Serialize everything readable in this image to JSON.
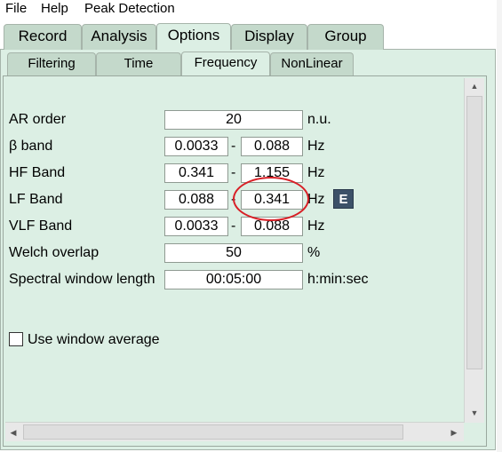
{
  "menubar": {
    "file": "File",
    "help": "Help",
    "peak_detection": "Peak Detection"
  },
  "main_tabs": [
    {
      "label": "Record",
      "active": false
    },
    {
      "label": "Analysis",
      "active": false
    },
    {
      "label": "Options",
      "active": true
    },
    {
      "label": "Display",
      "active": false
    },
    {
      "label": "Group",
      "active": false
    }
  ],
  "sub_tabs": [
    {
      "label": "Filtering",
      "active": false
    },
    {
      "label": "Time",
      "active": false
    },
    {
      "label": "Frequency",
      "active": true
    },
    {
      "label": "NonLinear",
      "active": false
    }
  ],
  "form": {
    "ar_order": {
      "label": "AR order",
      "value": "20",
      "unit": "n.u."
    },
    "beta_band": {
      "label": "β band",
      "low": "0.0033",
      "high": "0.088",
      "unit": "Hz"
    },
    "hf_band": {
      "label": "HF Band",
      "low": "0.341",
      "high": "1.155",
      "unit": "Hz"
    },
    "lf_band": {
      "label": "LF Band",
      "low": "0.088",
      "high": "0.341",
      "unit": "Hz",
      "button": "E"
    },
    "vlf_band": {
      "label": "VLF Band",
      "low": "0.0033",
      "high": "0.088",
      "unit": "Hz"
    },
    "welch_overlap": {
      "label": "Welch overlap",
      "value": "50",
      "unit": "%"
    },
    "spectral_window": {
      "label": "Spectral window length",
      "value": "00:05:00",
      "unit": "h:min:sec"
    },
    "range_separator": "-"
  },
  "use_window_average": {
    "label": "Use window average",
    "checked": false
  },
  "colors": {
    "panel": "#dcefe4",
    "tab": "#c4d9cb",
    "e_button": "#3c5168",
    "annotation": "#d81f26"
  }
}
